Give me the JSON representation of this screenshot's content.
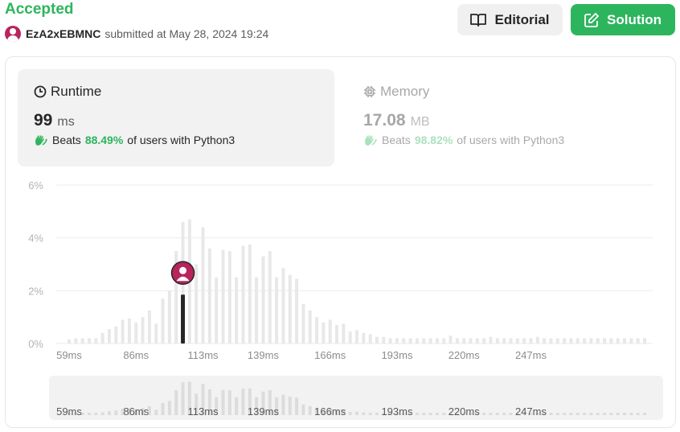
{
  "header": {
    "status": "Accepted",
    "username": "EzA2xEBMNC",
    "submitted_text": "submitted at May 28, 2024 19:24",
    "editorial_label": "Editorial",
    "solution_label": "Solution"
  },
  "runtime": {
    "title": "Runtime",
    "value": "99",
    "unit": "ms",
    "beats_label": "Beats",
    "beats_pct": "88.49%",
    "beats_suffix": "of users with Python3"
  },
  "memory": {
    "title": "Memory",
    "value": "17.08",
    "unit": "MB",
    "beats_label": "Beats",
    "beats_pct": "98.82%",
    "beats_suffix": "of users with Python3"
  },
  "colors": {
    "accent_green": "#2db55d",
    "bar": "#e8e8e8",
    "user_bar": "#262626",
    "avatar": "#b8245e"
  },
  "chart_data": {
    "type": "bar",
    "ylim": [
      0,
      6
    ],
    "yticks": [
      "0%",
      "2%",
      "4%",
      "6%"
    ],
    "ytick_values": [
      0,
      2,
      4,
      6
    ],
    "xticks": [
      "59ms",
      "86ms",
      "113ms",
      "139ms",
      "166ms",
      "193ms",
      "220ms",
      "247ms"
    ],
    "values": [
      0.15,
      0.2,
      0.2,
      0.2,
      0.2,
      0.4,
      0.55,
      0.65,
      0.9,
      0.95,
      0.8,
      1.0,
      1.25,
      0.75,
      1.7,
      2.0,
      3.5,
      4.6,
      4.7,
      3.0,
      4.4,
      3.6,
      2.5,
      3.55,
      3.5,
      2.5,
      3.7,
      3.75,
      2.5,
      3.3,
      3.5,
      2.5,
      2.85,
      2.6,
      2.45,
      1.5,
      1.25,
      1.0,
      0.8,
      0.9,
      0.7,
      0.75,
      0.45,
      0.5,
      0.4,
      0.35,
      0.25,
      0.25,
      0.2,
      0.2,
      0.2,
      0.2,
      0.2,
      0.2,
      0.2,
      0.2,
      0.2,
      0.3,
      0.2,
      0.2,
      0.2,
      0.2,
      0.2,
      0.25,
      0.2,
      0.2,
      0.2,
      0.2,
      0.2,
      0.2,
      0.25,
      0.2,
      0.2,
      0.2,
      0.2,
      0.2,
      0.2,
      0.2,
      0.2,
      0.2,
      0.2,
      0.2,
      0.2,
      0.2,
      0.2,
      0.2,
      0.2
    ],
    "user_index": 17,
    "user_value": 1.85
  }
}
